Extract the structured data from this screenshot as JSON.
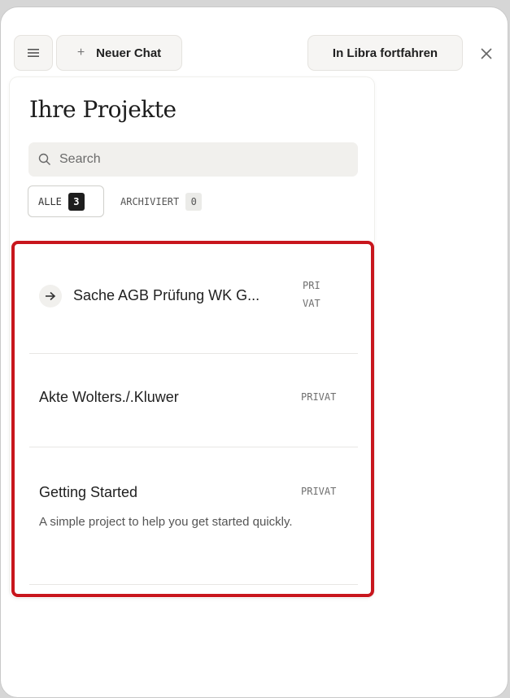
{
  "header": {
    "new_chat_label": "Neuer Chat",
    "new_chat_icon": "+",
    "continue_label": "In Libra fortfahren"
  },
  "panel": {
    "title": "Ihre Projekte",
    "search_placeholder": "Search",
    "filters": [
      {
        "label": "ALLE",
        "count": "3",
        "active": true
      },
      {
        "label": "ARCHIVIERT",
        "count": "0",
        "active": false
      }
    ]
  },
  "projects": [
    {
      "name": "Sache AGB Prüfung WK G...",
      "visibility": "PRIVAT",
      "description": "",
      "icon": "arrow-right-icon"
    },
    {
      "name": "Akte Wolters./.Kluwer",
      "visibility": "PRIVAT",
      "description": ""
    },
    {
      "name": "Getting Started",
      "visibility": "PRIVAT",
      "description": "A simple project to help you get started quickly."
    }
  ],
  "colors": {
    "highlight": "#c8161d",
    "count_badge_bg": "#1e1e1e",
    "surface": "#f6f5f3"
  }
}
